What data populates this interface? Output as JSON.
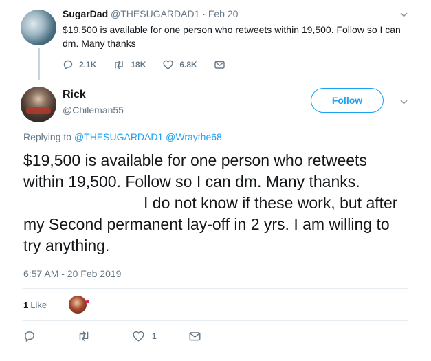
{
  "parent": {
    "name": "SugarDad",
    "handle": "@THESUGARDAD1",
    "separator": "·",
    "date": "Feb 20",
    "text": "$19,500 is available for one person who retweets within 19,500. Follow so I can dm. Many thanks",
    "actions": {
      "replies": "2.1K",
      "retweets": "18K",
      "likes": "6.8K"
    }
  },
  "tweet": {
    "name": "Rick",
    "handle": "@Chileman55",
    "follow_label": "Follow",
    "replying_to_label": "Replying to",
    "mentions": [
      "@THESUGARDAD1",
      "@Wraythe68"
    ],
    "text_part1": "$19,500 is available for one person who retweets within 19,500. Follow so I can dm. Many thanks.",
    "text_part2": "I do not know if these work, but after my Second permanent lay-off in 2 yrs. I am willing to try anything.",
    "timestamp": "6:57 AM - 20 Feb 2019",
    "likes_count": "1",
    "likes_label": "Like",
    "actions": {
      "likes": "1"
    }
  },
  "icons": {
    "reply": "reply-icon",
    "retweet": "retweet-icon",
    "like": "heart-icon",
    "dm": "envelope-icon",
    "more": "chevron-down-icon"
  },
  "colors": {
    "accent": "#1da1f2",
    "muted": "#657786",
    "text": "#14171a",
    "divider": "#e6ecf0"
  }
}
